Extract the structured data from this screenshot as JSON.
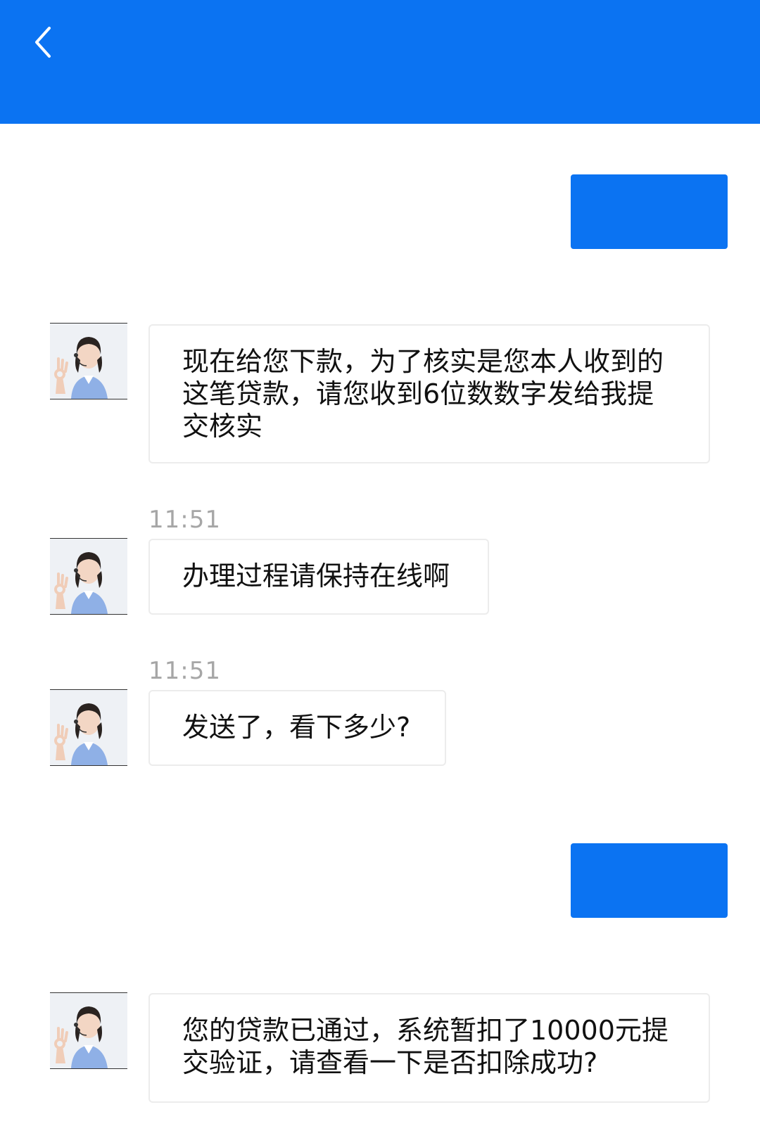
{
  "header": {
    "back_icon": "chevron-left-icon",
    "background_color": "#0b73f2"
  },
  "messages": [
    {
      "type": "outgoing",
      "text": ""
    },
    {
      "type": "incoming",
      "text": "现在给您下款，为了核实是您本人收到的这笔贷款，请您收到6位数数字发给我提交核实"
    },
    {
      "type": "incoming",
      "time": "11:51",
      "text": "办理过程请保持在线啊"
    },
    {
      "type": "incoming",
      "time": "11:51",
      "text": "发送了，看下多少?"
    },
    {
      "type": "outgoing",
      "text": ""
    },
    {
      "type": "incoming",
      "text": "您的贷款已通过，系统暂扣了10000元提交验证，请查看一下是否扣除成功?"
    }
  ],
  "colors": {
    "accent": "#0b73f2",
    "timestamp": "#a6a6a6",
    "bubble_border": "#ececec"
  }
}
